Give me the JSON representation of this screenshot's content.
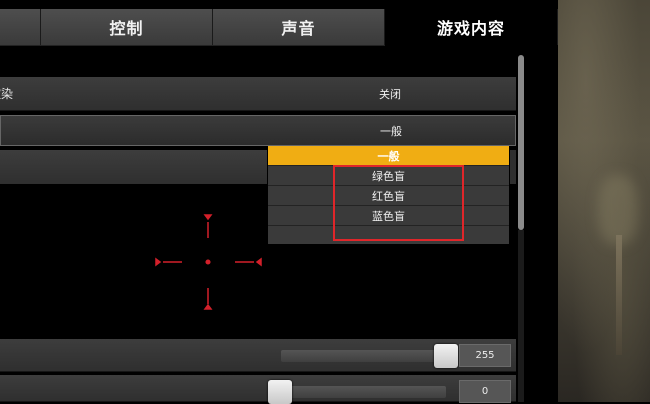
{
  "tabs": [
    {
      "label": ""
    },
    {
      "label": "控制"
    },
    {
      "label": "声音"
    },
    {
      "label": "游戏内容"
    }
  ],
  "settings": {
    "render_row": {
      "label": "渲染",
      "value": "关闭"
    },
    "dropdown": {
      "value": "一般"
    }
  },
  "dropdown_menu": {
    "options": [
      "一般",
      "绿色盲",
      "红色盲",
      "蓝色盲"
    ],
    "selected": "一般"
  },
  "sliders": [
    {
      "value_text": "255",
      "fill": 1.0
    },
    {
      "value_text": "0",
      "fill": 0.0
    }
  ],
  "colors": {
    "accent_selected": "#f0ad13",
    "crosshair": "#d4202a",
    "annotation_box": "#e0262a"
  }
}
